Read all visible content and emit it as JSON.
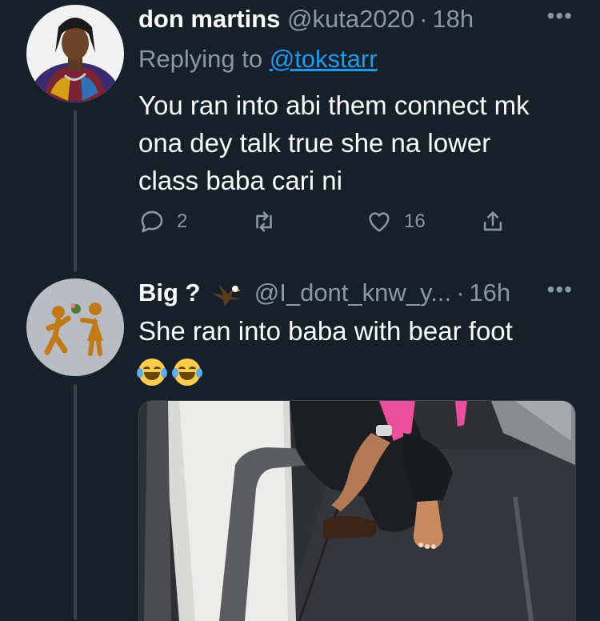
{
  "tweets": [
    {
      "display_name": "don martins",
      "handle": "@kuta2020",
      "separator": "·",
      "time": "18h",
      "replying_prefix": "Replying to",
      "replying_to": "@tokstarr",
      "text_lines": [
        "You ran into abi them connect mk",
        "ona dey talk true she na lower",
        "class baba cari ni"
      ],
      "replies": "2",
      "retweets": "",
      "likes": "16",
      "more_icon": "more-horizontal-icon"
    },
    {
      "display_name": "Big ?",
      "handle": "@I_dont_knw_y...",
      "separator": "·",
      "time": "16h",
      "text": "She ran into baba with bear foot",
      "emojis": [
        "face-with-tears-of-joy",
        "face-with-tears-of-joy"
      ],
      "more_icon": "more-horizontal-icon"
    }
  ],
  "colors": {
    "background": "#15202b",
    "muted": "#8899a6",
    "link": "#1d9bf0",
    "thread_line": "#38444d"
  }
}
